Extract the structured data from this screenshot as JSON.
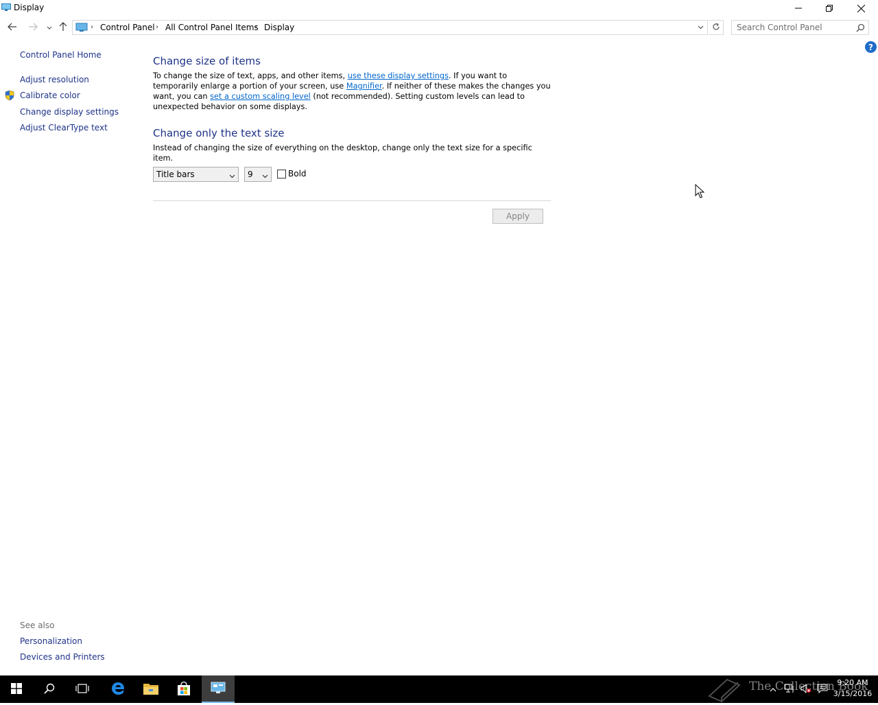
{
  "window": {
    "title": "Display"
  },
  "navigation": {
    "breadcrumbs": [
      "Control Panel",
      "All Control Panel Items",
      "Display"
    ],
    "search_placeholder": "Search Control Panel"
  },
  "sidebar": {
    "home": "Control Panel Home",
    "items": [
      {
        "label": "Adjust resolution"
      },
      {
        "label": "Calibrate color",
        "icon": "shield-icon"
      },
      {
        "label": "Change display settings"
      },
      {
        "label": "Adjust ClearType text"
      }
    ],
    "see_also_title": "See also",
    "see_also": [
      {
        "label": "Personalization"
      },
      {
        "label": "Devices and Printers"
      }
    ]
  },
  "main": {
    "section1": {
      "heading": "Change size of items",
      "text_a": "To change the size of text, apps, and other items, ",
      "link_a": "use these display settings",
      "text_b": ".  If you want to temporarily enlarge a portion of your screen, use ",
      "link_b": "Magnifier",
      "text_c": ".  If neither of these makes the changes you want, you can ",
      "link_c": "set a custom scaling level",
      "text_d": " (not recommended).  Setting custom levels can lead to unexpected behavior on some displays."
    },
    "section2": {
      "heading": "Change only the text size",
      "description": "Instead of changing the size of everything on the desktop, change only the text size for a specific item.",
      "item_select": "Title bars",
      "size_select": "9",
      "bold_label": "Bold",
      "bold_checked": false
    },
    "apply_label": "Apply"
  },
  "taskbar": {
    "time": "9:20 AM",
    "date": "3/15/2016",
    "watermark": "The Collection Book"
  },
  "colors": {
    "link": "#1e3287",
    "inline_link": "#0066cc",
    "heading": "#1e3287",
    "help": "#1e6cc8",
    "taskbar": "#000000"
  }
}
